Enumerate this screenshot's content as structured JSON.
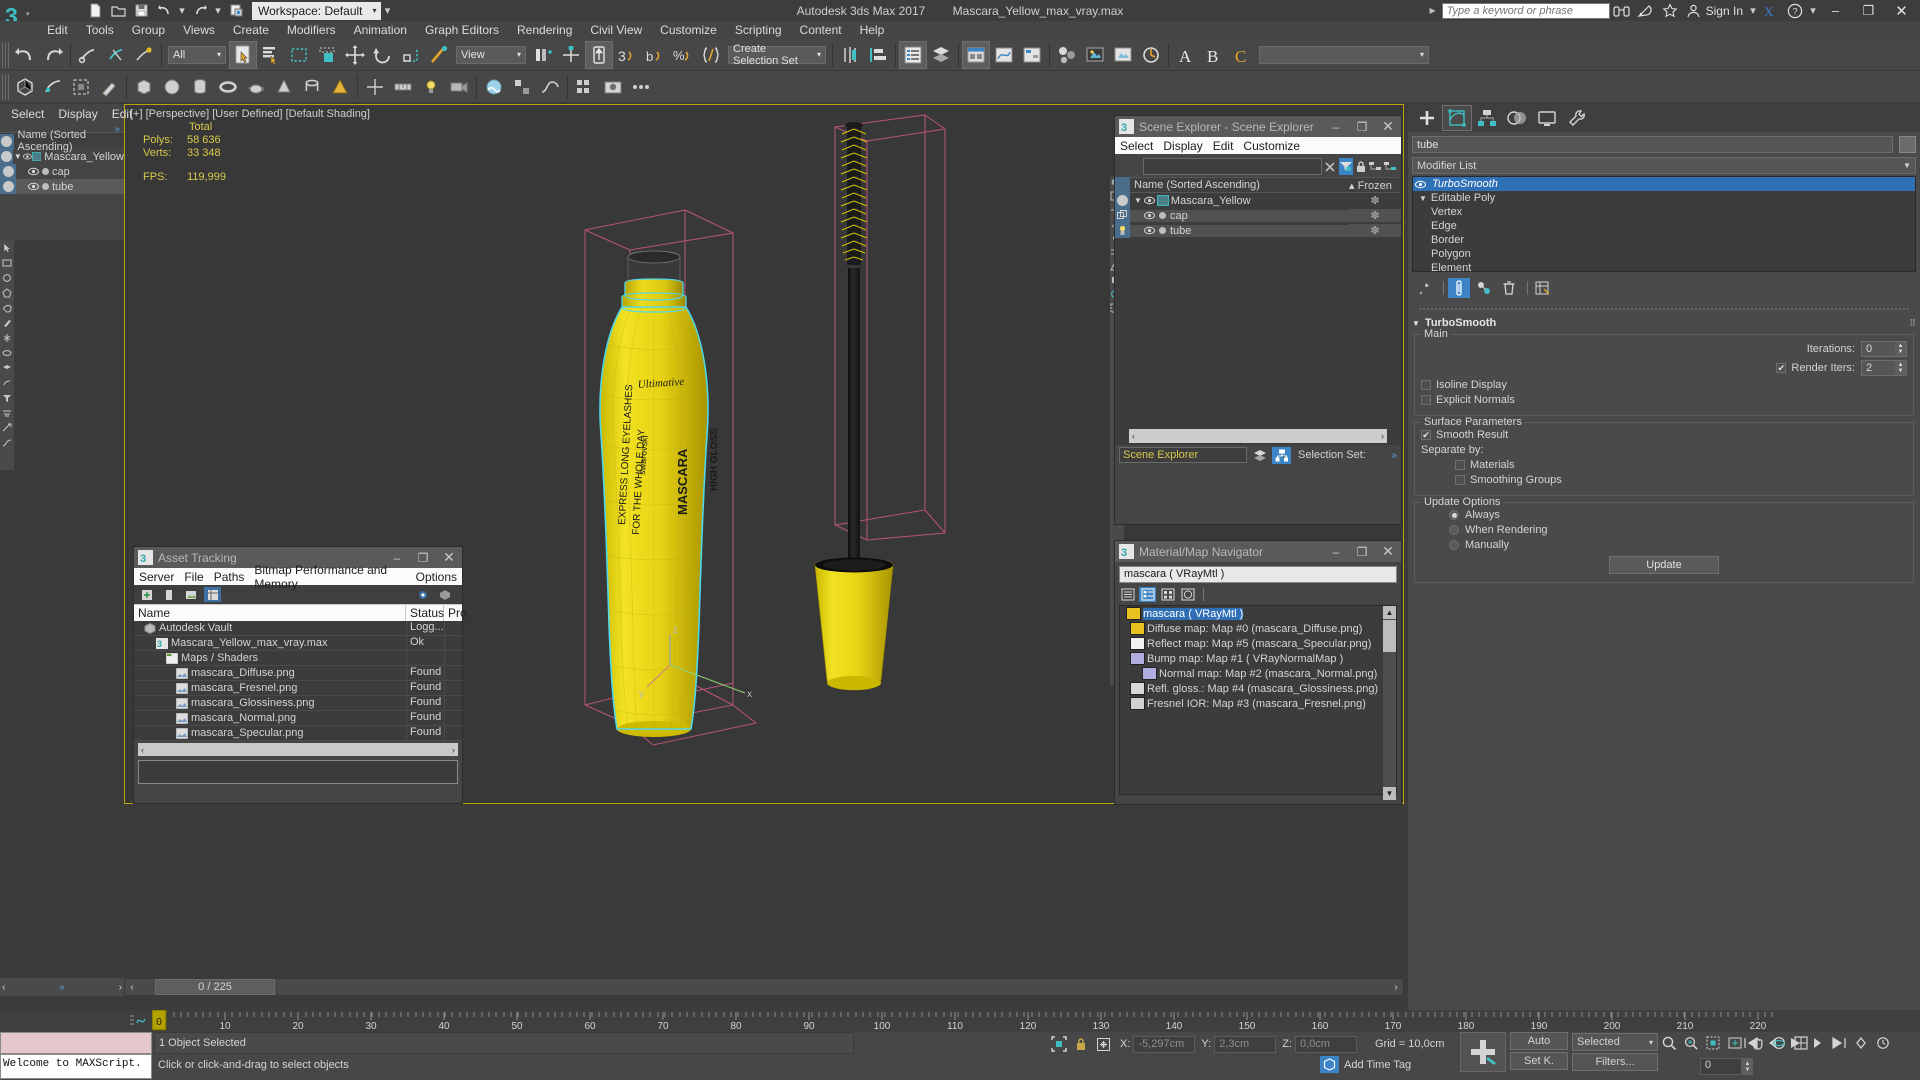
{
  "titlebar": {
    "workspace": "Workspace: Default",
    "app_title": "Autodesk 3ds Max 2017",
    "file_name": "Mascara_Yellow_max_vray.max",
    "search_placeholder": "Type a keyword or phrase",
    "sign_in": "Sign In",
    "minimize": "–",
    "restore": "❐",
    "close": "✕"
  },
  "menubar": {
    "items": [
      "Edit",
      "Tools",
      "Group",
      "Views",
      "Create",
      "Modifiers",
      "Animation",
      "Graph Editors",
      "Rendering",
      "Civil View",
      "Customize",
      "Scripting",
      "Content",
      "Help"
    ]
  },
  "toolbar": {
    "selection_filter": "All",
    "reference_coord": "View",
    "selection_set": "Create Selection Set"
  },
  "viewport": {
    "label": "[+] [Perspective] [User Defined] [Default Shading]",
    "stats_total": "Total",
    "polys_label": "Polys:",
    "polys_value": "58 636",
    "verts_label": "Verts:",
    "verts_value": "33 348",
    "fps_label": "FPS:",
    "fps_value": "119,999",
    "axis_z": "z",
    "axis_y": "y",
    "axis_x": "x"
  },
  "left_explorer": {
    "menu": [
      "Select",
      "Display",
      "Edit"
    ],
    "column_header": "Name (Sorted Ascending)",
    "rows": [
      {
        "name": "Mascara_Yellow",
        "level": 0
      },
      {
        "name": "cap",
        "level": 1
      },
      {
        "name": "tube",
        "level": 1,
        "selected": true
      }
    ]
  },
  "scene_explorer": {
    "title": "Scene Explorer - Scene Explorer",
    "menu": [
      "Select",
      "Display",
      "Edit",
      "Customize"
    ],
    "search_value": "",
    "col_name": "Name (Sorted Ascending)",
    "col_frozen": "Frozen",
    "sort_marker": "▴",
    "rows": [
      {
        "name": "Mascara_Yellow",
        "level": 0,
        "selected": false
      },
      {
        "name": "cap",
        "level": 1,
        "selected": true
      },
      {
        "name": "tube",
        "level": 1,
        "selected": true
      }
    ],
    "footer_field": "Scene Explorer",
    "selection_set_label": "Selection Set:",
    "scroll_left": "‹",
    "scroll_right": "›"
  },
  "material_navigator": {
    "title": "Material/Map Navigator",
    "field_value": "mascara  ( VRayMtl )",
    "rows": [
      {
        "label": "mascara  ( VRayMtl )",
        "level": 0,
        "selected": true,
        "color": "#e8c220"
      },
      {
        "label": "Diffuse map: Map #0 (mascara_Diffuse.png)",
        "level": 1,
        "selected": false,
        "color": "#e8c220"
      },
      {
        "label": "Reflect map: Map #5 (mascara_Specular.png)",
        "level": 1,
        "selected": false,
        "color": "#f2f2f2"
      },
      {
        "label": "Bump map: Map #1  ( VRayNormalMap )",
        "level": 1,
        "selected": false,
        "color": "#b0aee0"
      },
      {
        "label": "Normal map: Map #2 (mascara_Normal.png)",
        "level": 2,
        "selected": false,
        "color": "#b0aee0"
      },
      {
        "label": "Refl. gloss.: Map #4 (mascara_Glossiness.png)",
        "level": 1,
        "selected": false,
        "color": "#d8d8d8"
      },
      {
        "label": "Fresnel IOR: Map #3 (mascara_Fresnel.png)",
        "level": 1,
        "selected": false,
        "color": "#d0d0d0"
      }
    ]
  },
  "asset_tracking": {
    "title": "Asset Tracking",
    "menu": [
      "Server",
      "File",
      "Paths",
      "Bitmap Performance and Memory",
      "Options"
    ],
    "columns": [
      "Name",
      "Status",
      "Pro"
    ],
    "rows": [
      {
        "name": "Autodesk Vault",
        "status": "Logg...",
        "level": 0,
        "icon": "vault"
      },
      {
        "name": "Mascara_Yellow_max_vray.max",
        "status": "Ok",
        "level": 1,
        "icon": "max"
      },
      {
        "name": "Maps / Shaders",
        "status": "",
        "level": 2,
        "icon": "folder"
      },
      {
        "name": "mascara_Diffuse.png",
        "status": "Found",
        "level": 3,
        "icon": "bitmap"
      },
      {
        "name": "mascara_Fresnel.png",
        "status": "Found",
        "level": 3,
        "icon": "bitmap"
      },
      {
        "name": "mascara_Glossiness.png",
        "status": "Found",
        "level": 3,
        "icon": "bitmap"
      },
      {
        "name": "mascara_Normal.png",
        "status": "Found",
        "level": 3,
        "icon": "bitmap"
      },
      {
        "name": "mascara_Specular.png",
        "status": "Found",
        "level": 3,
        "icon": "bitmap"
      }
    ],
    "scroll_left": "‹",
    "scroll_right": "›"
  },
  "command_panel": {
    "object_name": "tube",
    "modifier_list": "Modifier List",
    "stack": [
      {
        "label": "TurboSmooth",
        "selected": true,
        "level": 0
      },
      {
        "label": "Editable Poly",
        "selected": false,
        "level": 0
      },
      {
        "label": "Vertex",
        "selected": false,
        "level": 1
      },
      {
        "label": "Edge",
        "selected": false,
        "level": 1
      },
      {
        "label": "Border",
        "selected": false,
        "level": 1
      },
      {
        "label": "Polygon",
        "selected": false,
        "level": 1
      },
      {
        "label": "Element",
        "selected": false,
        "level": 1
      }
    ],
    "rollout_title": "TurboSmooth",
    "group_main": "Main",
    "iterations_label": "Iterations:",
    "iterations_value": "0",
    "render_iters_label": "Render Iters:",
    "render_iters_value": "2",
    "render_iters_checked": true,
    "isoline_label": "Isoline Display",
    "isoline_checked": false,
    "explicit_label": "Explicit Normals",
    "explicit_checked": false,
    "group_surface": "Surface Parameters",
    "smooth_result_label": "Smooth Result",
    "smooth_result_checked": true,
    "separate_by_label": "Separate by:",
    "materials_label": "Materials",
    "materials_checked": false,
    "smoothing_groups_label": "Smoothing Groups",
    "smoothing_groups_checked": false,
    "group_update": "Update Options",
    "update_always": "Always",
    "update_when_rendering": "When Rendering",
    "update_manually": "Manually",
    "update_selected": "Always",
    "update_button": "Update"
  },
  "status_bar": {
    "maxscript_listener": "Welcome to MAXScript.",
    "selection_status": "1 Object Selected",
    "prompt": "Click or click-and-drag to select objects",
    "x_label": "X:",
    "x_value": "-5,297cm",
    "y_label": "Y:",
    "y_value": "2,3cm",
    "z_label": "Z:",
    "z_value": "0,0cm",
    "grid": "Grid = 10,0cm",
    "add_time_tag": "Add Time Tag",
    "auto_key": "Auto",
    "set_key": "Set K.",
    "selected_filter": "Selected",
    "filters": "Filters...",
    "key_frame": "0",
    "frame_range": "0 / 225"
  },
  "timeline": {
    "current_frame_label": "0",
    "ticks": [
      "0",
      "10",
      "20",
      "30",
      "40",
      "50",
      "60",
      "70",
      "80",
      "90",
      "100",
      "110",
      "120",
      "130",
      "140",
      "150",
      "160",
      "170",
      "180",
      "190",
      "200",
      "210",
      "220"
    ]
  },
  "colors": {
    "accent_blue": "#3c84c6",
    "highlight_yellow": "#d8c94a",
    "mascara_yellow": "#e8d41a",
    "viewport_bg": "#383838",
    "panel_bg": "#4a4a4a",
    "selection_cyan": "#4fd8e8"
  }
}
